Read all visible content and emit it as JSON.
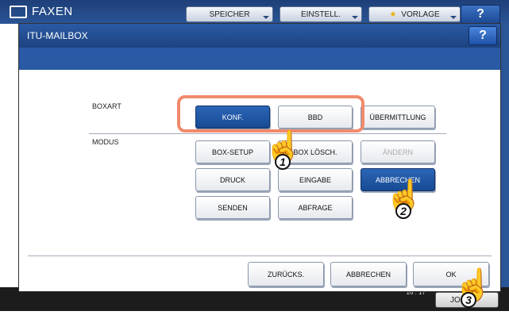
{
  "background": {
    "title": "FAXEN",
    "tabs": [
      "SPEICHER",
      "EINSTELL.",
      "VORLAGE"
    ],
    "help": "?",
    "time": "16 : 17",
    "job": "JOB"
  },
  "dialog": {
    "title": "ITU-MAILBOX",
    "help": "?",
    "boxart_label": "BOXART",
    "modus_label": "MODUS",
    "boxart_buttons": [
      "KONF.",
      "BBD",
      "ÜBERMITTLUNG"
    ],
    "modus_buttons": [
      "BOX-SETUP",
      "BOX LÖSCH.",
      "ÄNDERN",
      "DRUCK",
      "EINGABE",
      "ABBRECHEN",
      "SENDEN",
      "ABFRAGE"
    ],
    "footer_buttons": [
      "ZURÜCKS.",
      "ABBRECHEN",
      "OK"
    ]
  },
  "callouts": [
    "1",
    "2",
    "3"
  ],
  "colors": {
    "highlight": "#f08a6c",
    "selected": "#1f57a4",
    "titlebar": "#1d437f"
  }
}
